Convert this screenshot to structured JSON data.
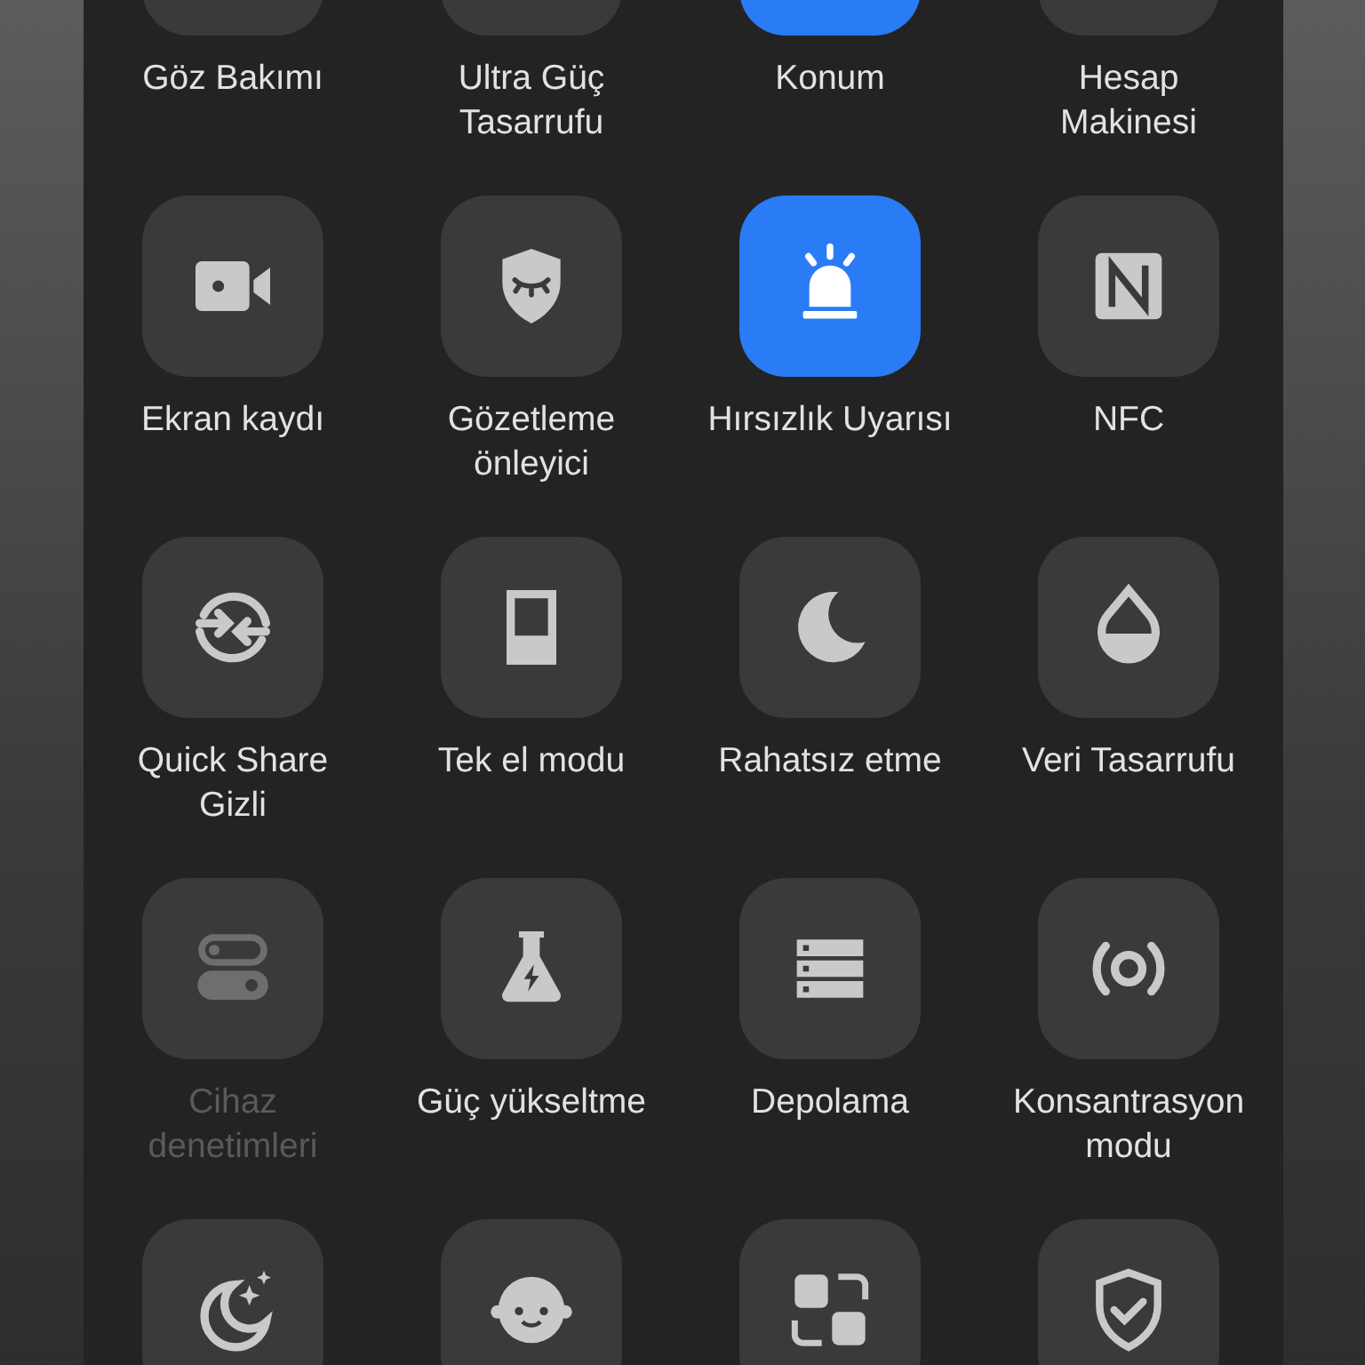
{
  "rows": [
    {
      "tiles": [
        {
          "label": "Göz Bakımı",
          "on": false
        },
        {
          "label": "Ultra Güç\nTasarrufu",
          "on": false
        },
        {
          "label": "Konum",
          "on": true
        },
        {
          "label": "Hesap\nMakinesi",
          "on": false
        }
      ]
    },
    {
      "tiles": [
        {
          "label": "Ekran kaydı",
          "on": false,
          "disabled": false
        },
        {
          "label": "Gözetleme\nönleyici",
          "on": false,
          "disabled": false
        },
        {
          "label": "Hırsızlık Uyarısı",
          "on": true,
          "disabled": false
        },
        {
          "label": "NFC",
          "on": false,
          "disabled": false
        }
      ]
    },
    {
      "tiles": [
        {
          "label": "Quick Share\nGizli",
          "on": false,
          "disabled": false
        },
        {
          "label": "Tek el modu",
          "on": false,
          "disabled": false
        },
        {
          "label": "Rahatsız etme",
          "on": false,
          "disabled": false
        },
        {
          "label": "Veri Tasarrufu",
          "on": false,
          "disabled": false
        }
      ]
    },
    {
      "tiles": [
        {
          "label": "Cihaz\ndenetimleri",
          "on": false,
          "disabled": true
        },
        {
          "label": "Güç yükseltme",
          "on": false,
          "disabled": false
        },
        {
          "label": "Depolama",
          "on": false,
          "disabled": false
        },
        {
          "label": "Konsantrasyon\nmodu",
          "on": false,
          "disabled": false
        }
      ]
    },
    {
      "tiles": [
        {
          "on": false,
          "disabled": false
        },
        {
          "on": false,
          "disabled": false
        },
        {
          "on": false,
          "disabled": false
        },
        {
          "on": false,
          "disabled": false
        }
      ]
    }
  ]
}
